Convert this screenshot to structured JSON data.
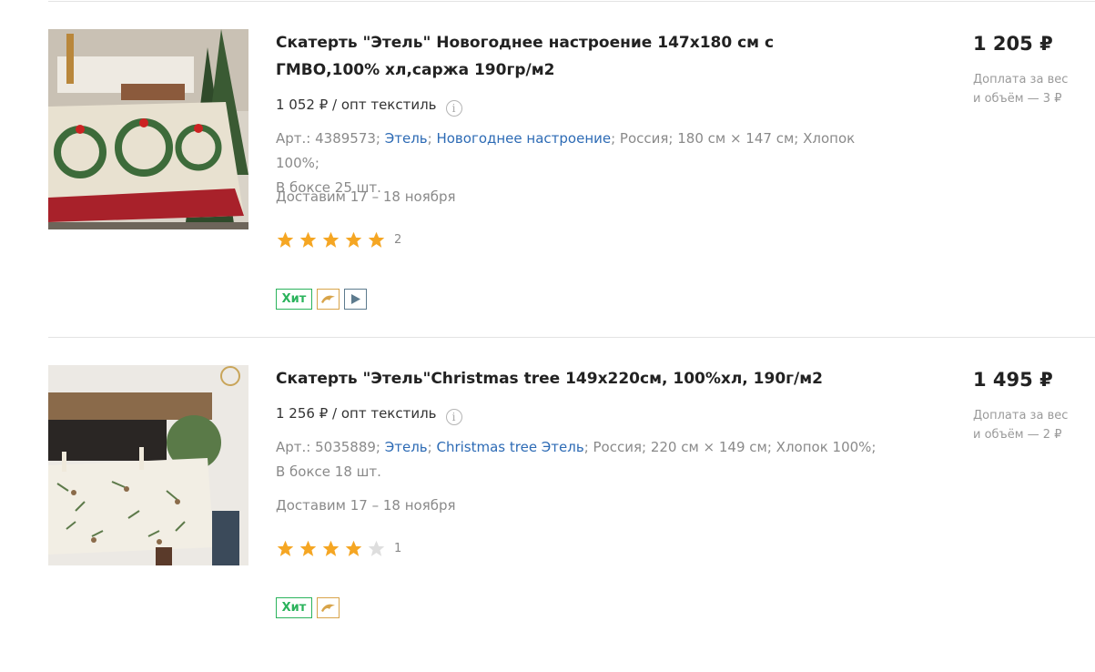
{
  "products": [
    {
      "title": "Скатерть \"Этель\" Новогоднее настроение 147х180 см с ГМВО,100% хл,саржа 190гр/м2",
      "opt_price": "1 052 ₽ / опт текстиль",
      "article": "Арт.: 4389573;",
      "brand": "Этель",
      "sep1": ";",
      "collection": "Новогоднее настроение",
      "details": "; Россия; 180 см × 147 см; Хлопок 100%;",
      "box": "В боксе 25 шт.",
      "delivery": "Доставим 17 – 18 ноября",
      "rating": 5,
      "reviews": "2",
      "badge_hit": "Хит",
      "has_video": true,
      "price": "1 205 ₽",
      "surcharge": "Доплата за вес и объём — 3 ₽"
    },
    {
      "title": "Скатерть \"Этель\"Christmas tree 149х220см, 100%хл, 190г/м2",
      "opt_price": "1 256 ₽ / опт текстиль",
      "article": "Арт.: 5035889;",
      "brand": "Этель",
      "sep1": ";",
      "collection": "Christmas tree Этель",
      "details": "; Россия; 220 см × 149 см; Хлопок 100%;",
      "box": "В боксе 18 шт.",
      "delivery": "Доставим 17 – 18 ноября",
      "rating": 4,
      "reviews": "1",
      "badge_hit": "Хит",
      "has_video": false,
      "price": "1 495 ₽",
      "surcharge": "Доплата за вес и объём — 2 ₽"
    }
  ],
  "colors": {
    "link": "#2d6bb5",
    "star_filled": "#f5a623",
    "star_empty": "#dedede",
    "hit_badge": "#2bb35c"
  },
  "icons": {
    "info": "i",
    "video_play": "▶"
  }
}
